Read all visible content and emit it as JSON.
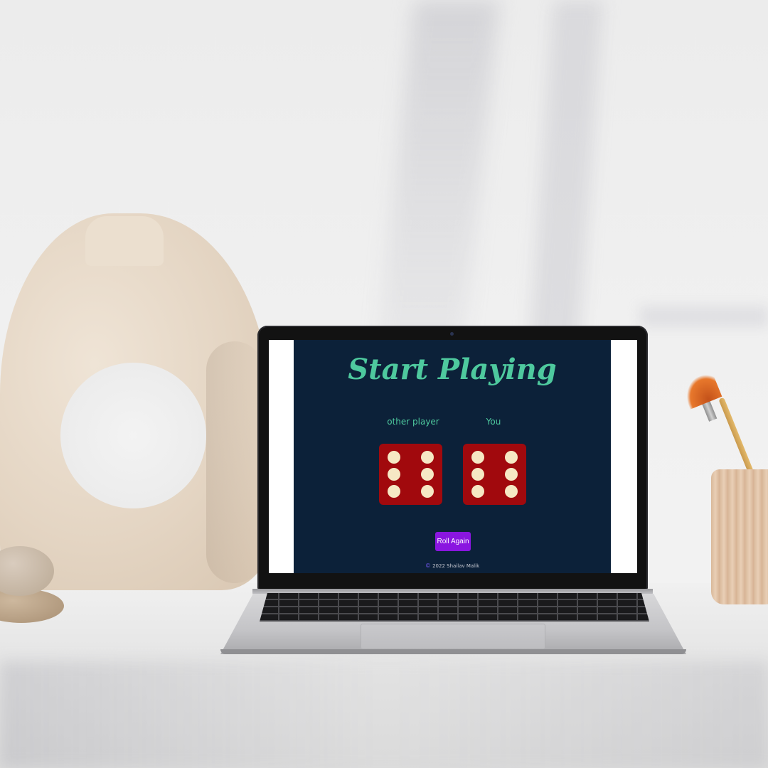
{
  "app": {
    "title": "Start Playing",
    "players": {
      "other_label": "other player",
      "you_label": "You"
    },
    "dice": [
      {
        "owner": "other player",
        "value": 6
      },
      {
        "owner": "You",
        "value": 6
      }
    ],
    "roll_button_label": "Roll Again",
    "footer": {
      "copyright_symbol": "©",
      "text": "2022 Shailav Malik"
    }
  },
  "colors": {
    "app_background": "#0c2139",
    "accent_teal": "#4ec99e",
    "die_red": "#a1090d",
    "pip_cream": "#f6e8c4",
    "button_purple": "#8a16e0"
  }
}
